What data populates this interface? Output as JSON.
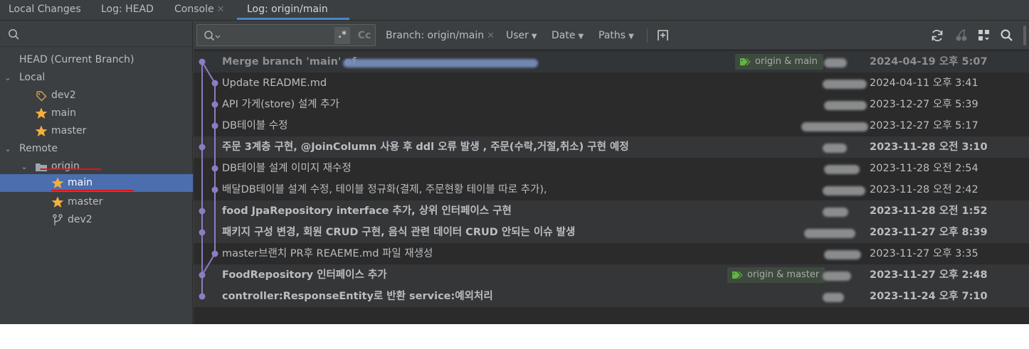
{
  "tabs": [
    {
      "label": "Local Changes",
      "closable": false
    },
    {
      "label": "Log: HEAD",
      "closable": false
    },
    {
      "label": "Console",
      "closable": true
    },
    {
      "label": "Log: origin/main",
      "closable": false,
      "active": true
    }
  ],
  "branch_tree": {
    "head": "HEAD (Current Branch)",
    "local_label": "Local",
    "local": [
      "dev2",
      "main",
      "master"
    ],
    "remote_label": "Remote",
    "origin_label": "origin",
    "origin": [
      "main",
      "master",
      "dev2"
    ]
  },
  "toolbar": {
    "regex_label": ".*",
    "case_label": "Cc",
    "branch_label": "Branch: origin/main",
    "user_label": "User",
    "date_label": "Date",
    "paths_label": "Paths"
  },
  "commits": [
    {
      "message": "Merge branch 'main' of",
      "date": "2024-04-19 오후 5:07",
      "style": "faded",
      "tag": "origin & main"
    },
    {
      "message": "Update README.md",
      "date": "2024-04-11 오후 3:41",
      "style": "normal"
    },
    {
      "message": "API 가게(store) 설계 추가",
      "date": "2023-12-27 오후 5:39",
      "style": "normal"
    },
    {
      "message": "DB테이블 수정",
      "date": "2023-12-27 오후 5:17",
      "style": "normal"
    },
    {
      "message": "주문 3계층 구현, @JoinColumn 사용 후 ddl 오류 발생 , 주문(수락,거절,취소) 구현 예정",
      "date": "2023-11-28 오전 3:10",
      "style": "bold"
    },
    {
      "message": "DB테이블 설계 이미지 재수정",
      "date": "2023-11-28 오전 2:54",
      "style": "normal"
    },
    {
      "message": "배달DB테이블 설계 수정, 테이블 정규화(결제, 주문현황 테이블 따로 추가),",
      "date": "2023-11-28 오전 2:42",
      "style": "normal"
    },
    {
      "message": "food JpaRepository interface 추가, 상위 인터페이스 구현",
      "date": "2023-11-28 오전 1:52",
      "style": "bold"
    },
    {
      "message": "패키지 구성 변경, 회원 CRUD 구현, 음식 관련 데이터 CRUD 안되는 이슈 발생",
      "date": "2023-11-27 오후 8:39",
      "style": "bold"
    },
    {
      "message": "master브랜치 PR후 REAEME.md 파일 재생성",
      "date": "2023-11-27 오후 3:35",
      "style": "normal"
    },
    {
      "message": "FoodRepository 인터페이스 추가",
      "date": "2023-11-27 오후 2:48",
      "style": "bold",
      "tag": "origin & master"
    },
    {
      "message": "controller:ResponseEntity로 반환 service:예외처리",
      "date": "2023-11-24 오후 7:10",
      "style": "bold"
    }
  ],
  "colors": {
    "graph": "#8e7cc3",
    "star": "#f4af3d",
    "selection": "#4b6eaf",
    "tag_icon": "#62b543",
    "annotation": "#e0141e"
  }
}
